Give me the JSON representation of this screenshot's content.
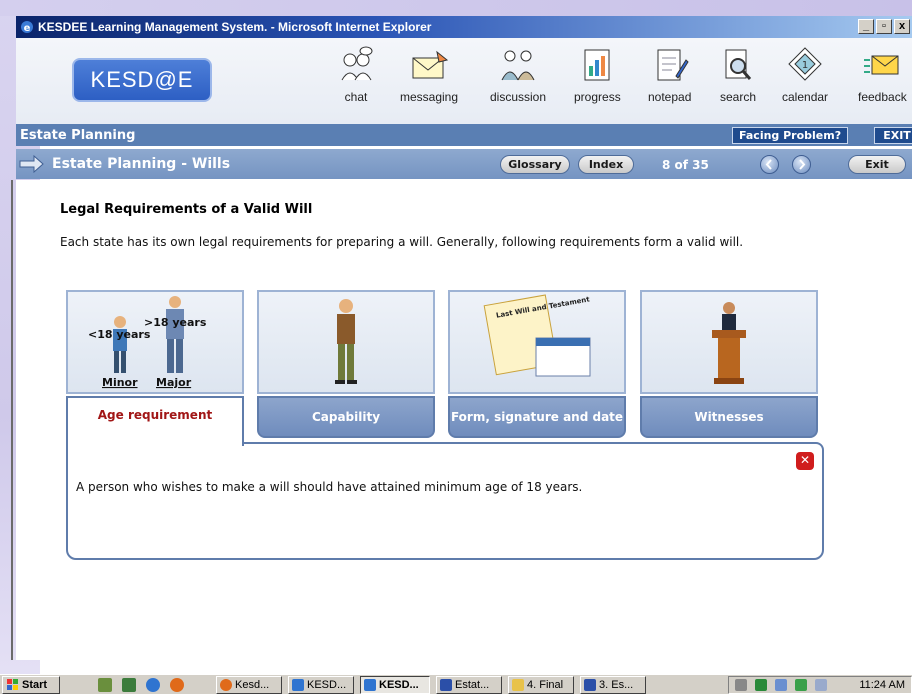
{
  "window": {
    "title": "KESDEE Learning Management System. - Microsoft Internet Explorer"
  },
  "app": {
    "logo_text": "KESD@E",
    "toolbar": [
      {
        "label": "chat",
        "icon": "chat-icon"
      },
      {
        "label": "messaging",
        "icon": "messaging-icon"
      },
      {
        "label": "discussion",
        "icon": "discussion-icon"
      },
      {
        "label": "progress",
        "icon": "progress-icon"
      },
      {
        "label": "notepad",
        "icon": "notepad-icon"
      },
      {
        "label": "search",
        "icon": "search-icon"
      },
      {
        "label": "calendar",
        "icon": "calendar-icon"
      },
      {
        "label": "feedback",
        "icon": "feedback-icon"
      }
    ]
  },
  "section": {
    "title": "Estate Planning",
    "facing_problem": "Facing Problem?",
    "exit": "EXIT"
  },
  "lesson": {
    "title": "Estate Planning - Wills",
    "glossary": "Glossary",
    "index": "Index",
    "page_indicator": "8 of 35",
    "exit": "Exit"
  },
  "content": {
    "heading": "Legal Requirements of a Valid Will",
    "intro": "Each state has its own legal requirements for preparing a will. Generally, following requirements form a valid will.",
    "image_labels": {
      "minor_age": "<18 years",
      "major_age": ">18 years",
      "minor": "Minor",
      "major": "Major",
      "document": "Last Will and Testament"
    },
    "tabs": [
      {
        "label": "Age requirement"
      },
      {
        "label": "Capability"
      },
      {
        "label": "Form, signature and date"
      },
      {
        "label": "Witnesses"
      }
    ],
    "active_tab": "Age requirement",
    "panel_text": "A person who wishes to make a will should have attained minimum age of 18 years.",
    "close": "✕"
  },
  "taskbar": {
    "start": "Start",
    "tasks": [
      "Kesd...",
      "KESD...",
      "KESD...",
      "Estat...",
      "4. Final",
      "3. Es..."
    ],
    "clock": "11:24 AM"
  },
  "colors": {
    "titlebar": "#0a246a",
    "section_bar": "#5a7fb3",
    "lesson_bar": "#7594c2",
    "active_tab_text": "#a11616",
    "close_button": "#d01d1d"
  }
}
